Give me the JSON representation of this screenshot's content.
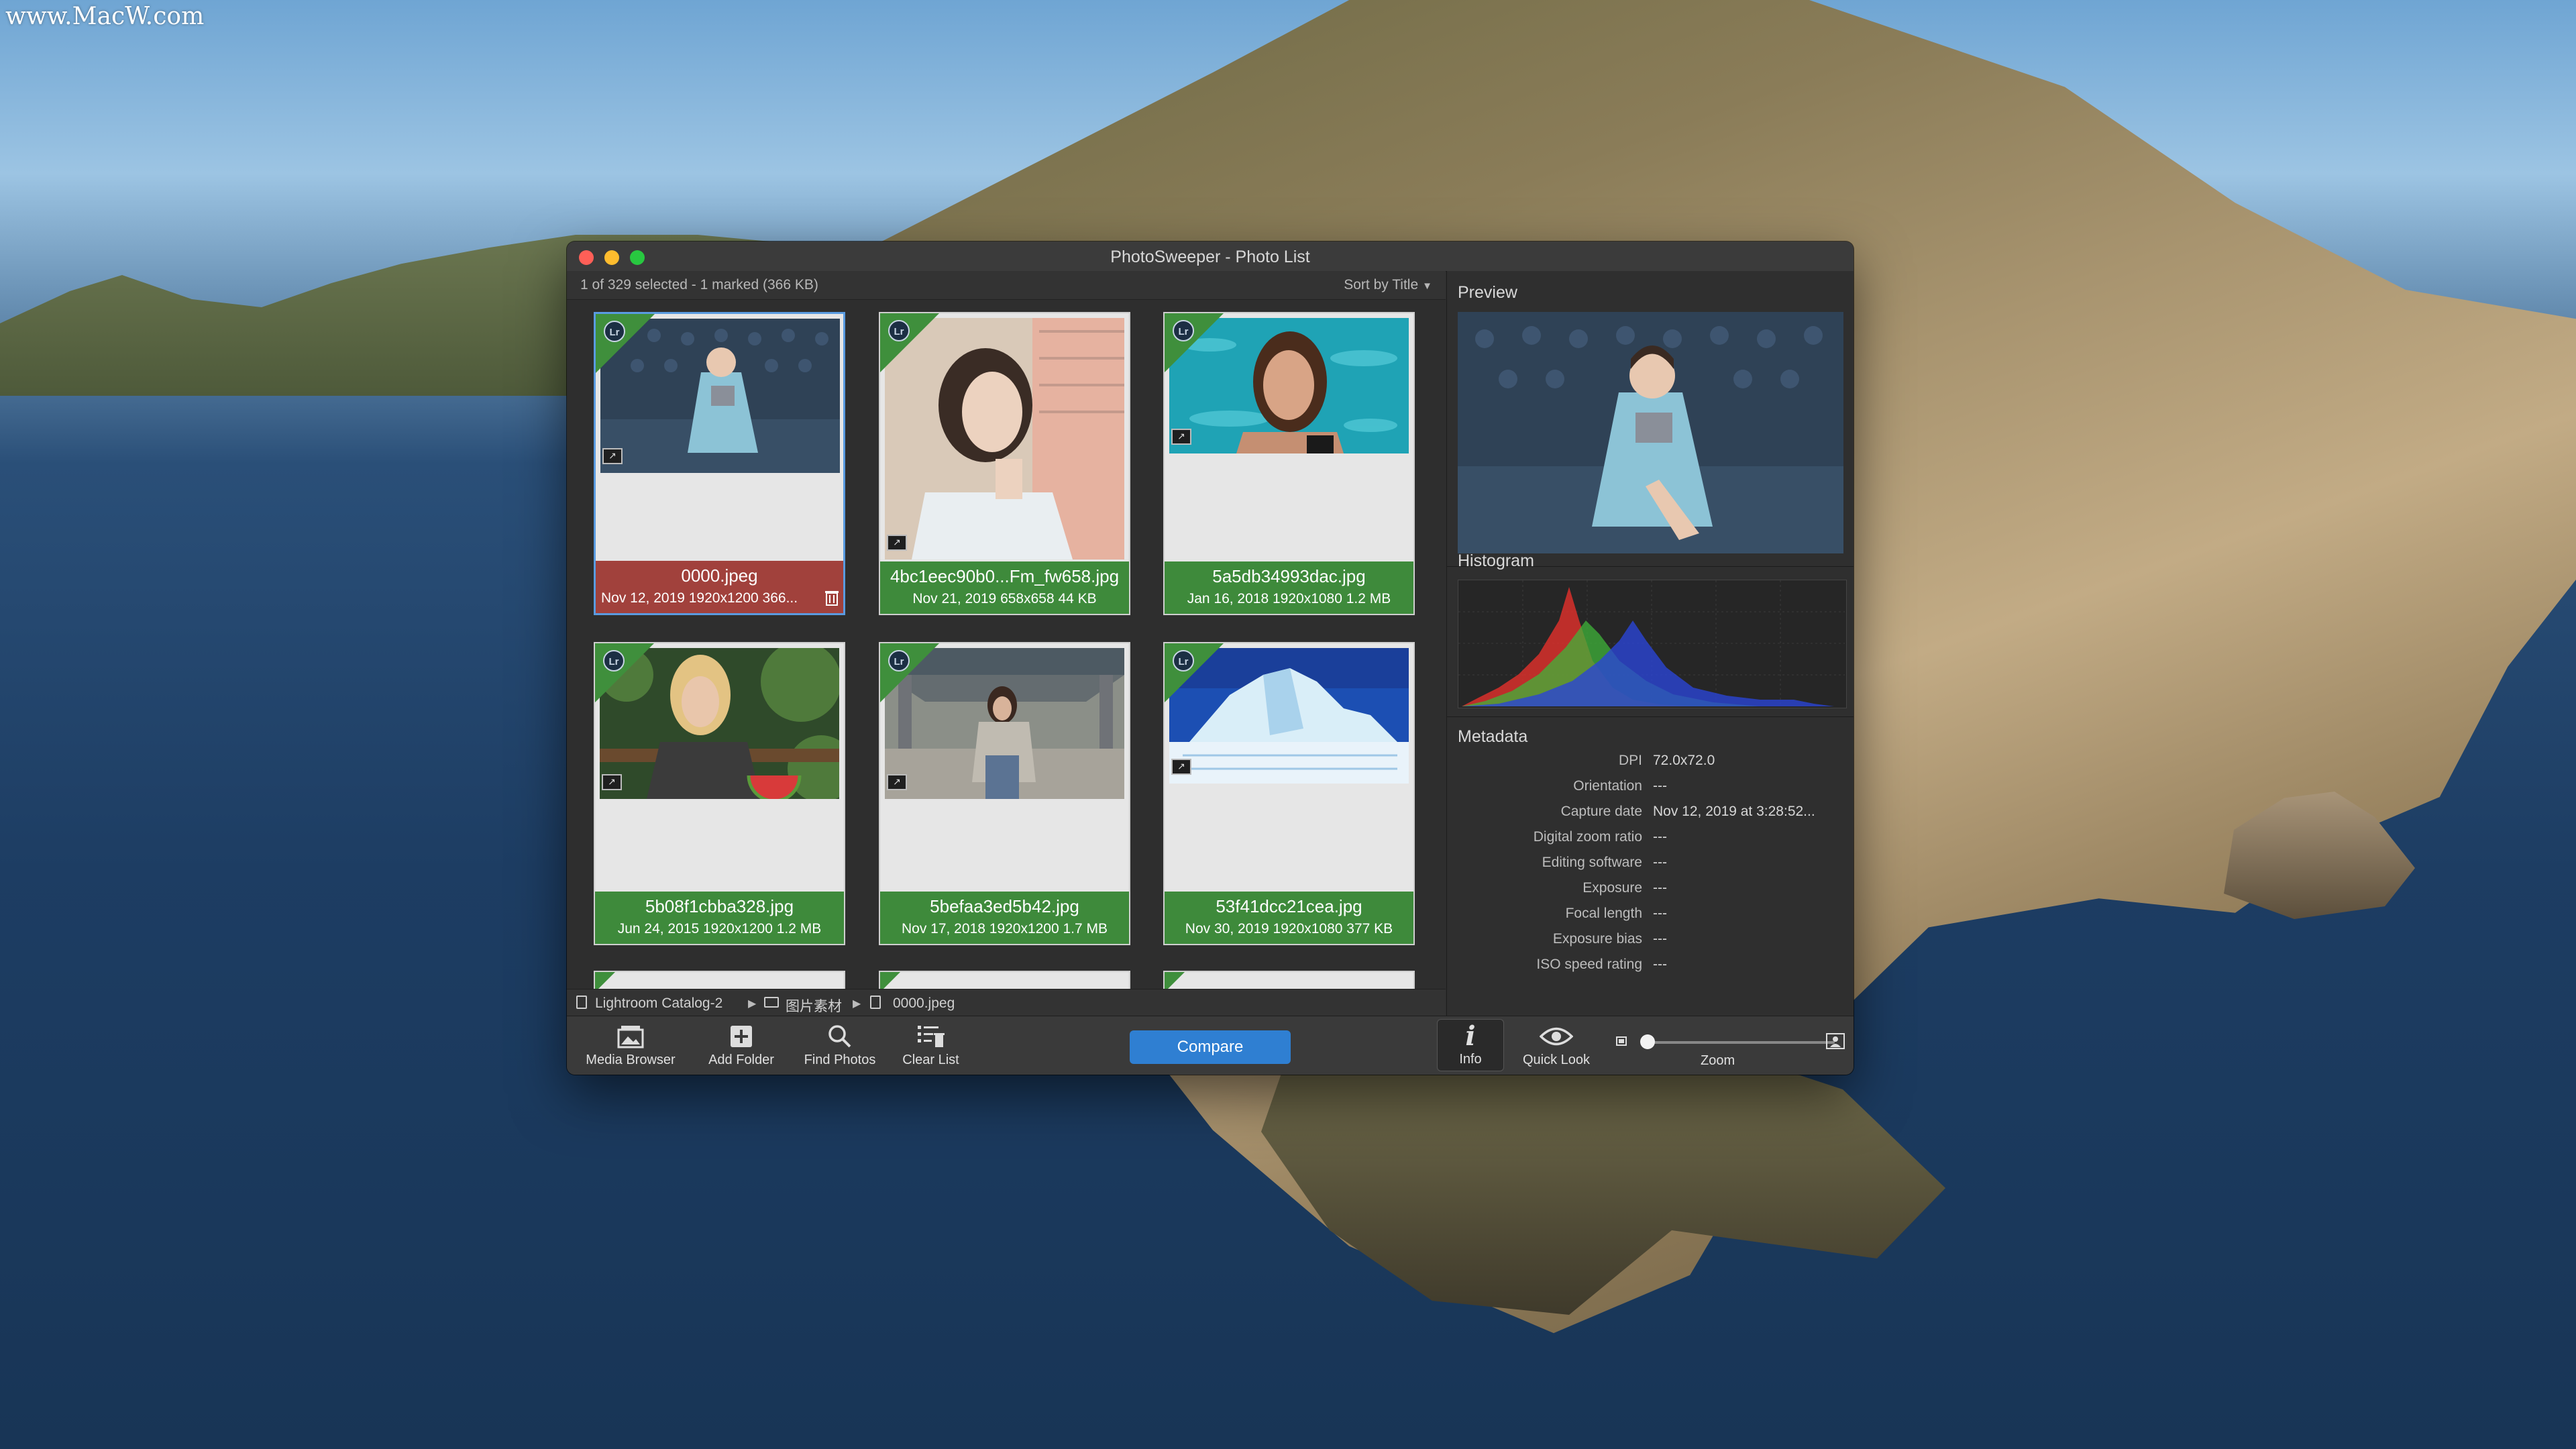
{
  "desktop": {
    "watermark": "www.MacW.com"
  },
  "window": {
    "title": "PhotoSweeper - Photo List",
    "selection_status": "1 of 329 selected - 1 marked (366 KB)",
    "sort_label": "Sort by Title"
  },
  "photos": [
    {
      "name": "0000.jpeg",
      "meta": "Nov 12, 2019  1920x1200  366...",
      "marked": true,
      "selected": true
    },
    {
      "name": "4bc1eec90b0...Fm_fw658.jpg",
      "meta": "Nov 21, 2019  658x658  44 KB",
      "marked": false,
      "selected": false
    },
    {
      "name": "5a5db34993dac.jpg",
      "meta": "Jan 16, 2018  1920x1080  1.2 MB",
      "marked": false,
      "selected": false
    },
    {
      "name": "5b08f1cbba328.jpg",
      "meta": "Jun 24, 2015  1920x1200  1.2 MB",
      "marked": false,
      "selected": false
    },
    {
      "name": "5befaa3ed5b42.jpg",
      "meta": "Nov 17, 2018  1920x1200  1.7 MB",
      "marked": false,
      "selected": false
    },
    {
      "name": "53f41dcc21cea.jpg",
      "meta": "Nov 30, 2019  1920x1080  377 KB",
      "marked": false,
      "selected": false
    }
  ],
  "lr_badge": "Lr",
  "path": {
    "catalog": "Lightroom Catalog-2",
    "folder": "图片素材",
    "file": "0000.jpeg"
  },
  "sidebar": {
    "preview_title": "Preview",
    "histogram_title": "Histogram",
    "metadata_title": "Metadata",
    "metadata": [
      {
        "key": "DPI",
        "value": "72.0x72.0"
      },
      {
        "key": "Orientation",
        "value": "---"
      },
      {
        "key": "Capture date",
        "value": "Nov 12, 2019 at 3:28:52..."
      },
      {
        "key": "Digital zoom ratio",
        "value": "---"
      },
      {
        "key": "Editing software",
        "value": "---"
      },
      {
        "key": "Exposure",
        "value": "---"
      },
      {
        "key": "Focal length",
        "value": "---"
      },
      {
        "key": "Exposure bias",
        "value": "---"
      },
      {
        "key": "ISO speed rating",
        "value": "---"
      }
    ]
  },
  "toolbar": {
    "media_browser": "Media Browser",
    "add_folder": "Add Folder",
    "find_photos": "Find Photos",
    "clear_list": "Clear List",
    "compare": "Compare",
    "info": "Info",
    "info_glyph": "i",
    "quick_look": "Quick Look",
    "zoom": "Zoom",
    "zoom_level": 0.0
  },
  "colors": {
    "label_green": "#3e8a3b",
    "label_marked": "#a1413c",
    "accent_blue": "#2f7fd2",
    "selection_border": "#5a9be0"
  }
}
